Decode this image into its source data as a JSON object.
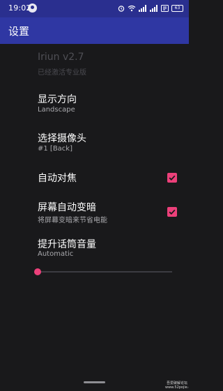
{
  "status_bar": {
    "time": "19:02",
    "battery": "63"
  },
  "app_bar": {
    "title": "设置"
  },
  "preferences": [
    {
      "title": "Iriun v2.7",
      "summary": "已经激活专业版",
      "enabled": false
    },
    {
      "title": "显示方向",
      "summary": "Landscape"
    },
    {
      "title": "选择摄像头",
      "summary": "#1 [Back]"
    },
    {
      "title": "自动对焦",
      "summary": "",
      "checked": true
    },
    {
      "title": "屏幕自动变暗",
      "summary": "将屏幕变暗来节省电能",
      "checked": true
    },
    {
      "title": "提升话筒音量",
      "summary": "Automatic",
      "slider_value": 0
    }
  ],
  "watermark": {
    "line1": "吾爱破解论坛",
    "line2": "www.52pojie.cn"
  },
  "colors": {
    "status_bar": "#2a2f8f",
    "app_bar": "#2f37a3",
    "background": "#19191b",
    "accent": "#ec407a"
  }
}
